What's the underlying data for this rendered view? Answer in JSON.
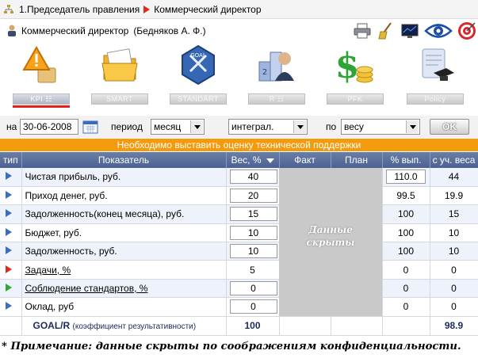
{
  "breadcrumb": {
    "level1": "1.Председатель правления",
    "level2": "Коммерческий директор"
  },
  "header": {
    "title": "Коммерческий директор",
    "user": "(Бедняков А. Ф.)"
  },
  "toolbar_icons": [
    "printer-icon",
    "broom-icon",
    "monitor-icon",
    "eye-icon",
    "target-icon"
  ],
  "modules": [
    {
      "label": "KPI",
      "icon": "kpi-warning-icon",
      "active": true
    },
    {
      "label": "SMART",
      "icon": "folders-icon",
      "active": false
    },
    {
      "label": "STANDART",
      "icon": "goal-badge-icon",
      "active": false
    },
    {
      "label": "R",
      "icon": "person-rating-icon",
      "active": false
    },
    {
      "label": "PFK",
      "icon": "dollar-coins-icon",
      "active": false
    },
    {
      "label": "Policy",
      "icon": "diploma-icon",
      "active": false
    }
  ],
  "filters": {
    "on_label": "на",
    "date": "30-06-2008",
    "period_label": "период",
    "period": "месяц",
    "mode": "интеграл.",
    "by_label": "по",
    "by": "весу",
    "ok": "OK"
  },
  "alert": "Необходимо выставить оценку технической поддержки",
  "table": {
    "headers": {
      "type": "тип",
      "indicator": "Показатель",
      "weight": "Вес, %",
      "fact": "Факт",
      "plan": "План",
      "pct": "% вып.",
      "weighted": "с уч. веса"
    },
    "rows": [
      {
        "name": "Чистая прибыль, руб.",
        "weight": "40",
        "pct": "110.0",
        "weighted": "44",
        "marker": "blue",
        "link": false
      },
      {
        "name": "Приход денег, руб.",
        "weight": "20",
        "pct": "99.5",
        "weighted": "19.9",
        "marker": "blue",
        "link": false
      },
      {
        "name": "Задолженность(конец месяца), руб.",
        "weight": "15",
        "pct": "100",
        "weighted": "15",
        "marker": "blue",
        "link": false
      },
      {
        "name": "Бюджет, руб.",
        "weight": "10",
        "pct": "100",
        "weighted": "10",
        "marker": "blue",
        "link": false
      },
      {
        "name": "Задолженность, руб.",
        "weight": "10",
        "pct": "100",
        "weighted": "10",
        "marker": "blue",
        "link": false
      },
      {
        "name": "Задачи, %",
        "weight": "5",
        "pct": "0",
        "weighted": "0",
        "marker": "red",
        "link": true
      },
      {
        "name": "Соблюдение стандартов, %",
        "weight": "0",
        "pct": "0",
        "weighted": "0",
        "marker": "green",
        "link": true
      },
      {
        "name": "Оклад, руб",
        "weight": "0",
        "pct": "0",
        "weighted": "0",
        "marker": "blue",
        "link": false
      }
    ],
    "total": {
      "label": "GOAL/R",
      "sublabel": "(коэффициент результативности)",
      "weight": "100",
      "weighted": "98.9"
    },
    "hidden_text": "Данные скрыты"
  },
  "footnote": "* Примечание: данные скрыты по соображениям конфиденциальности.",
  "colors": {
    "alert_bg": "#f39a0d",
    "header_bg": "#4c6192",
    "active_tab_underline": "#e3211b"
  }
}
